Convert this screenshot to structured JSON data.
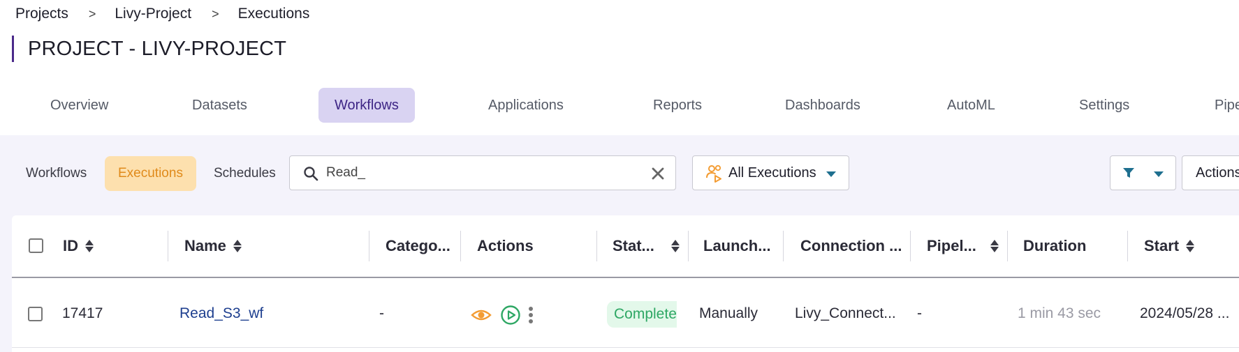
{
  "breadcrumb": {
    "items": [
      "Projects",
      "Livy-Project",
      "Executions"
    ],
    "separator": ">"
  },
  "page_title": "PROJECT - LIVY-PROJECT",
  "tabs": [
    {
      "label": "Overview",
      "active": false
    },
    {
      "label": "Datasets",
      "active": false
    },
    {
      "label": "Workflows",
      "active": true
    },
    {
      "label": "Applications",
      "active": false
    },
    {
      "label": "Reports",
      "active": false
    },
    {
      "label": "Dashboards",
      "active": false
    },
    {
      "label": "AutoML",
      "active": false
    },
    {
      "label": "Settings",
      "active": false
    },
    {
      "label": "Pipe",
      "active": false
    }
  ],
  "subtabs": [
    {
      "label": "Workflows",
      "active": false
    },
    {
      "label": "Executions",
      "active": true
    },
    {
      "label": "Schedules",
      "active": false
    }
  ],
  "search": {
    "value": "Read_",
    "icon": "search-icon",
    "clear_icon": "close-icon"
  },
  "executions_filter": {
    "label": "All Executions",
    "icon": "users-play-icon"
  },
  "filter_button": {
    "icon": "filter-icon"
  },
  "actions_button": {
    "label": "Actions"
  },
  "table": {
    "columns": [
      "ID",
      "Name",
      "Catego...",
      "Actions",
      "Stat...",
      "Launch...",
      "Connection ...",
      "Pipel...",
      "Duration",
      "Start"
    ],
    "rows": [
      {
        "id": "17417",
        "name": "Read_S3_wf",
        "category": "-",
        "status": "Complete",
        "launched": "Manually",
        "connection": "Livy_Connect...",
        "pipeline": "-",
        "duration": "1 min 43 sec",
        "start": "2024/05/28 ..."
      }
    ]
  },
  "colors": {
    "accent_purple": "#4b2a8a",
    "active_tab_bg": "#d9d3f2",
    "active_subtab_bg": "#fde0ae",
    "active_subtab_text": "#e08a1a",
    "band_bg": "#f4f3fb",
    "status_complete": "#2ea764",
    "link": "#1e3f8f",
    "eye_icon": "#f39c33",
    "play_icon": "#2ea764",
    "filter_icon": "#1e6f8f"
  }
}
